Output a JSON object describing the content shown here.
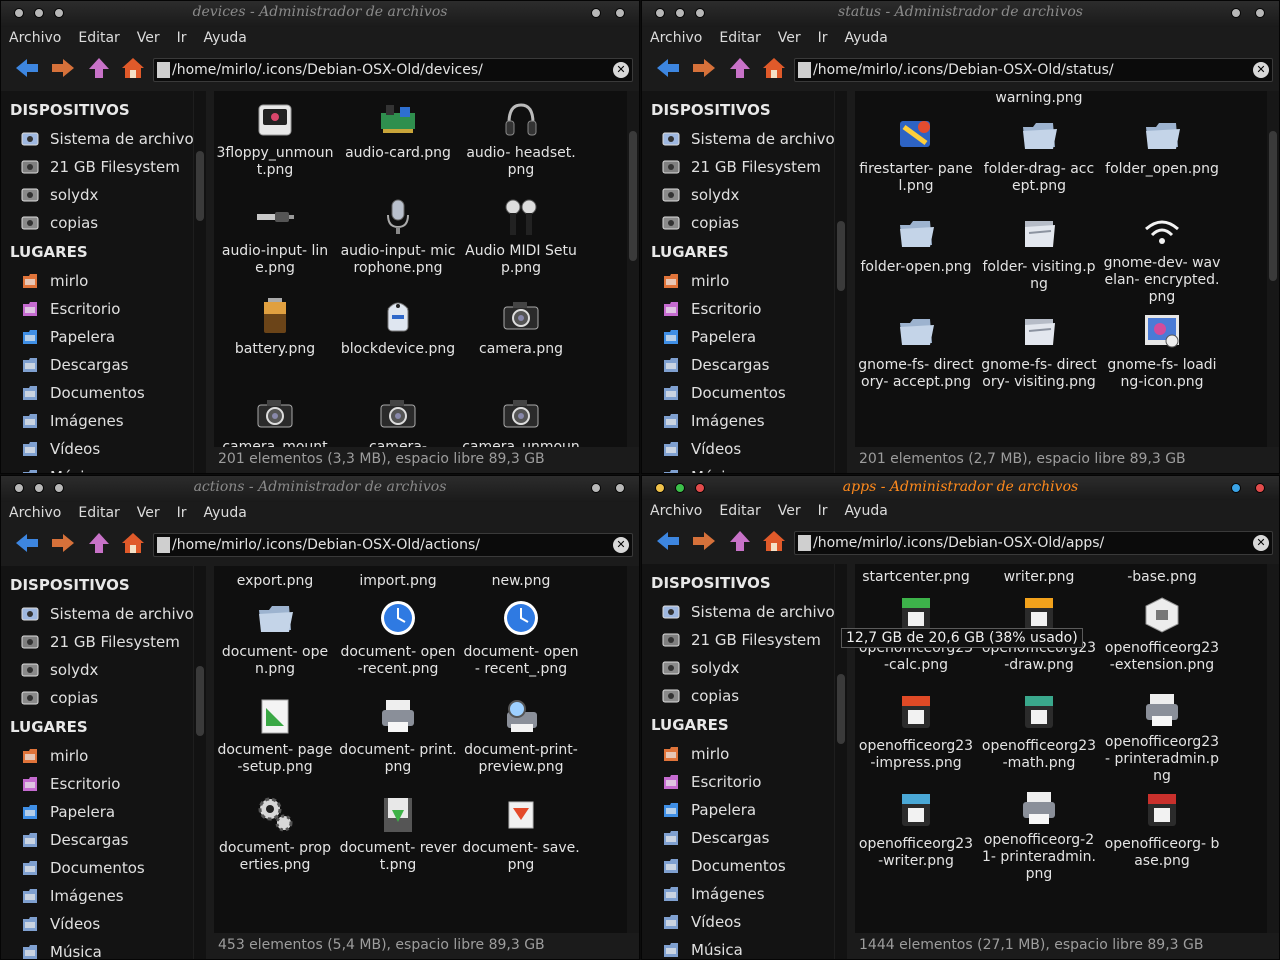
{
  "menu": [
    "Archivo",
    "Editar",
    "Ver",
    "Ir",
    "Ayuda"
  ],
  "sidebar": {
    "devices_header": "DISPOSITIVOS",
    "devices": [
      "Sistema de archivos",
      "21 GB Filesystem",
      "solydx",
      "copias"
    ],
    "places_header": "LUGARES",
    "places": [
      "mirlo",
      "Escritorio",
      "Papelera",
      "Descargas",
      "Documentos",
      "Imágenes",
      "Vídeos",
      "Música"
    ]
  },
  "windows": [
    {
      "id": "devices",
      "title": "devices - Administrador de archivos",
      "active": false,
      "path": "/home/mirlo/.icons/Debian-OSX-Old/devices/",
      "status": "201 elementos (3,3 MB), espacio libre 89,3 GB",
      "files": [
        {
          "name": "3floppy_unmoun t.png",
          "icon": "floppy-icon"
        },
        {
          "name": "audio-card.png",
          "icon": "audio-card-icon"
        },
        {
          "name": "audio- headset.png",
          "icon": "headset-icon"
        },
        {
          "name": "audio-input- line.png",
          "icon": "audio-jack-icon"
        },
        {
          "name": "audio-input- microphone.png",
          "icon": "microphone-icon"
        },
        {
          "name": "Audio MIDI Setup.png",
          "icon": "midi-icon"
        },
        {
          "name": "battery.png",
          "icon": "battery-icon"
        },
        {
          "name": "blockdevice.png",
          "icon": "robot-icon"
        },
        {
          "name": "camera.png",
          "icon": "camera-icon"
        },
        {
          "name": "camera_mount",
          "icon": "camera-icon"
        },
        {
          "name": "camera-",
          "icon": "camera-icon"
        },
        {
          "name": "camera_unmoun",
          "icon": "camera-icon"
        }
      ]
    },
    {
      "id": "status",
      "title": "status - Administrador de archivos",
      "active": false,
      "path": "/home/mirlo/.icons/Debian-OSX-Old/status/",
      "status": "201 elementos (2,7 MB), espacio libre 89,3 GB",
      "files": [
        {
          "name": "",
          "icon": ""
        },
        {
          "name": "warning.png",
          "icon": ""
        },
        {
          "name": "",
          "icon": ""
        },
        {
          "name": "firestarter- panel.png",
          "icon": "firewall-icon"
        },
        {
          "name": "folder-drag- accept.png",
          "icon": "folder-icon"
        },
        {
          "name": "folder_open.png",
          "icon": "folder-icon"
        },
        {
          "name": "folder-open.png",
          "icon": "folder-icon"
        },
        {
          "name": "folder- visiting.png",
          "icon": "folder-visiting-icon"
        },
        {
          "name": "gnome-dev- wavelan- encrypted.png",
          "icon": "wifi-icon"
        },
        {
          "name": "gnome-fs- directory- accept.png",
          "icon": "folder-icon"
        },
        {
          "name": "gnome-fs- directory- visiting.png",
          "icon": "folder-visiting-icon"
        },
        {
          "name": "gnome-fs- loading-icon.png",
          "icon": "loading-icon"
        }
      ]
    },
    {
      "id": "actions",
      "title": "actions - Administrador de archivos",
      "active": false,
      "path": "/home/mirlo/.icons/Debian-OSX-Old/actions/",
      "status": "453 elementos (5,4 MB), espacio libre 89,3 GB",
      "files": [
        {
          "name": "export.png",
          "icon": ""
        },
        {
          "name": "import.png",
          "icon": ""
        },
        {
          "name": "new.png",
          "icon": ""
        },
        {
          "name": "document- open.png",
          "icon": "folder-icon"
        },
        {
          "name": "document- open-recent.png",
          "icon": "clock-icon"
        },
        {
          "name": "document- open- recent_.png",
          "icon": "clock-icon"
        },
        {
          "name": "document- page-setup.png",
          "icon": "page-setup-icon"
        },
        {
          "name": "document- print.png",
          "icon": "printer-icon"
        },
        {
          "name": "document-print- preview.png",
          "icon": "print-preview-icon"
        },
        {
          "name": "document- properties.png",
          "icon": "gears-icon"
        },
        {
          "name": "document- revert.png",
          "icon": "revert-icon"
        },
        {
          "name": "document- save.png",
          "icon": "save-icon"
        }
      ]
    },
    {
      "id": "apps",
      "title": "apps - Administrador de archivos",
      "active": true,
      "path": "/home/mirlo/.icons/Debian-OSX-Old/apps/",
      "status": "1444 elementos (27,1 MB), espacio libre 89,3 GB",
      "tooltip": "12,7 GB de 20,6 GB (38% usado)",
      "files": [
        {
          "name": "startcenter.png",
          "icon": ""
        },
        {
          "name": "writer.png",
          "icon": ""
        },
        {
          "name": "-base.png",
          "icon": ""
        },
        {
          "name": "openofficeorg23 -calc.png",
          "icon": "calc-icon"
        },
        {
          "name": "openofficeorg23 -draw.png",
          "icon": "draw-icon"
        },
        {
          "name": "openofficeorg23 -extension.png",
          "icon": "extension-icon"
        },
        {
          "name": "openofficeorg23 -impress.png",
          "icon": "impress-icon"
        },
        {
          "name": "openofficeorg23 -math.png",
          "icon": "math-icon"
        },
        {
          "name": "openofficeorg23 - printeradmin.png",
          "icon": "printer-icon"
        },
        {
          "name": "openofficeorg23 -writer.png",
          "icon": "writer-icon"
        },
        {
          "name": "openofficeorg-2 1- printeradmin.png",
          "icon": "printer-icon"
        },
        {
          "name": "openofficeorg- base.png",
          "icon": "base-icon"
        }
      ]
    }
  ],
  "colors": {
    "accent": "#ff8a1c",
    "window_bg": "#1b1b1b",
    "content_bg": "#0f0f0f",
    "sidebar_bg": "#131313",
    "status_text": "#9d9d9d"
  }
}
